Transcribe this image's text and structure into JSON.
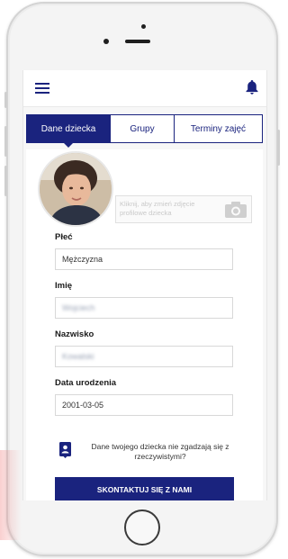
{
  "header": {
    "menu_icon": "hamburger-icon",
    "notification_icon": "bell-icon"
  },
  "tabs": [
    {
      "label": "Dane dziecka",
      "active": true
    },
    {
      "label": "Grupy",
      "active": false
    },
    {
      "label": "Terminy zajęć",
      "active": false
    }
  ],
  "profile": {
    "change_photo_hint": "Kliknij, aby zmień zdjęcie profilowe dziecka",
    "camera_icon": "camera-icon"
  },
  "form": {
    "gender_label": "Płeć",
    "gender_value": "Mężczyzna",
    "first_name_label": "Imię",
    "first_name_value": "Wojciech",
    "last_name_label": "Nazwisko",
    "last_name_value": "Kowalski",
    "birth_date_label": "Data urodzenia",
    "birth_date_value": "2001-03-05"
  },
  "info": {
    "text": "Dane twojego dziecka nie zgadzają się z rzeczywistymi?",
    "icon": "contact-card-icon"
  },
  "cta": {
    "label": "SKONTAKTUJ SIĘ Z NAMI"
  },
  "colors": {
    "primary": "#1a237e",
    "background": "#f7f7f7"
  }
}
